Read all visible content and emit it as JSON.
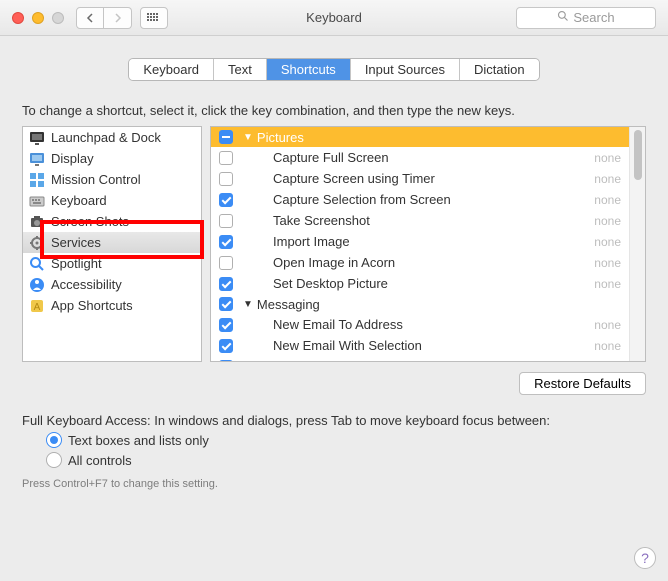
{
  "window": {
    "title": "Keyboard",
    "search_placeholder": "Search"
  },
  "tabs": [
    "Keyboard",
    "Text",
    "Shortcuts",
    "Input Sources",
    "Dictation"
  ],
  "active_tab": 2,
  "hint": "To change a shortcut, select it, click the key combination, and then type the new keys.",
  "categories": [
    {
      "label": "Launchpad & Dock"
    },
    {
      "label": "Display"
    },
    {
      "label": "Mission Control"
    },
    {
      "label": "Keyboard"
    },
    {
      "label": "Screen Shots"
    },
    {
      "label": "Services",
      "selected": true
    },
    {
      "label": "Spotlight"
    },
    {
      "label": "Accessibility"
    },
    {
      "label": "App Shortcuts"
    }
  ],
  "groups": [
    {
      "label": "Pictures",
      "state": "mixed",
      "selected": true,
      "items": [
        {
          "label": "Capture Full Screen",
          "checked": false,
          "shortcut": "none"
        },
        {
          "label": "Capture Screen using Timer",
          "checked": false,
          "shortcut": "none"
        },
        {
          "label": "Capture Selection from Screen",
          "checked": true,
          "shortcut": "none"
        },
        {
          "label": "Take Screenshot",
          "checked": false,
          "shortcut": "none"
        },
        {
          "label": "Import Image",
          "checked": true,
          "shortcut": "none"
        },
        {
          "label": "Open Image in Acorn",
          "checked": false,
          "shortcut": "none"
        },
        {
          "label": "Set Desktop Picture",
          "checked": true,
          "shortcut": "none"
        }
      ]
    },
    {
      "label": "Messaging",
      "state": "checked",
      "selected": false,
      "items": [
        {
          "label": "New Email To Address",
          "checked": true,
          "shortcut": "none"
        },
        {
          "label": "New Email With Selection",
          "checked": true,
          "shortcut": "none"
        }
      ]
    }
  ],
  "restore_label": "Restore Defaults",
  "fka": {
    "title": "Full Keyboard Access: In windows and dialogs, press Tab to move keyboard focus between:",
    "opt1": "Text boxes and lists only",
    "opt2": "All controls",
    "selected": 0
  },
  "footnote": "Press Control+F7 to change this setting.",
  "help": "?"
}
